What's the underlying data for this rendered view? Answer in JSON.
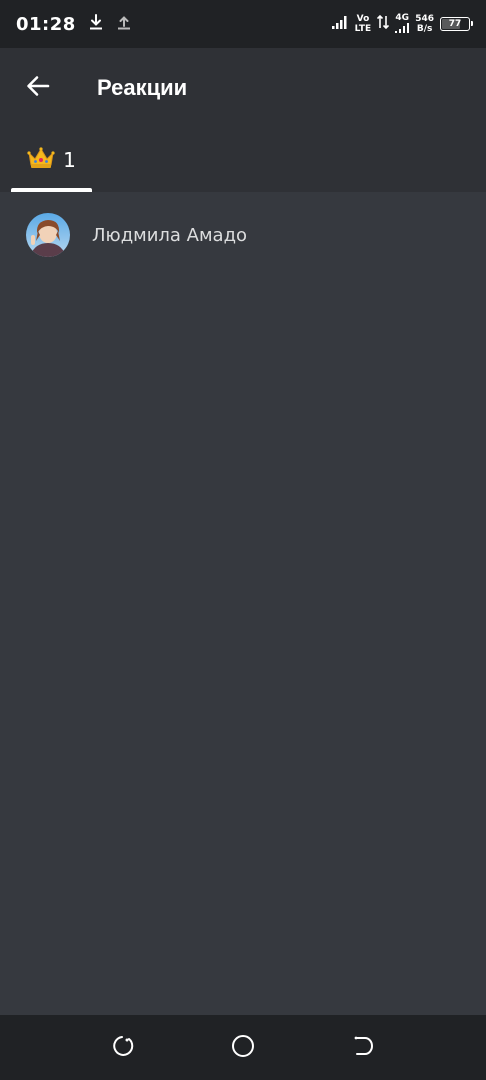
{
  "status_bar": {
    "time": "01:28",
    "volte_top": "Vo",
    "volte_bottom": "LTE",
    "network_type": "4G",
    "speed_value": "546",
    "speed_unit": "B/s",
    "battery_level": "77",
    "battery_fraction": 0.77
  },
  "header": {
    "title": "Реакции"
  },
  "tabs": [
    {
      "emoji": "👑",
      "count": "1",
      "selected": true
    }
  ],
  "reactions_list": [
    {
      "name": "Людмила Амадо"
    }
  ],
  "colors": {
    "background": "#36393f",
    "header": "#2f3136",
    "status_bar": "#202225",
    "accent": "#ffffff"
  },
  "icons": {
    "back": "arrow-left-icon",
    "download": "download-icon",
    "upload": "upload-icon",
    "signal": "signal-icon",
    "battery": "battery-icon",
    "nav_recent": "recent-apps-icon",
    "nav_home": "home-icon",
    "nav_back": "back-nav-icon"
  }
}
